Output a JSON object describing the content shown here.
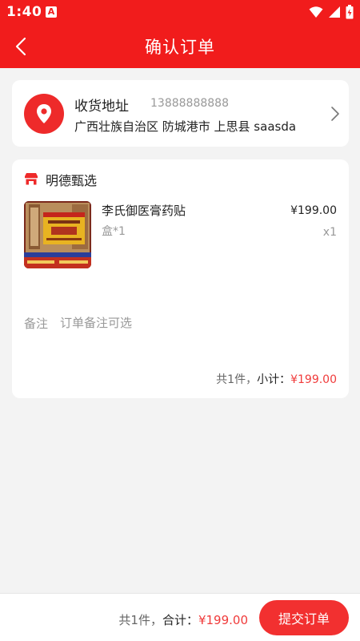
{
  "status_bar": {
    "time": "1:40",
    "app_icon_letter": "A"
  },
  "header": {
    "title": "确认订单"
  },
  "address": {
    "title": "收货地址",
    "phone": "13888888888",
    "detail": "广西壮族自治区 防城港市 上思县 saasda"
  },
  "store": {
    "name": "明德甄选"
  },
  "product": {
    "name": "李氏御医膏药贴",
    "spec": "盒*1",
    "price": "¥199.00",
    "quantity": "x1"
  },
  "remark": {
    "label": "备注",
    "placeholder": "订单备注可选"
  },
  "subtotal": {
    "count_text": "共1件，",
    "label": "小计：",
    "amount": "¥199.00"
  },
  "footer": {
    "count_text": "共1件，",
    "label": "合计：",
    "amount": "¥199.00",
    "submit_label": "提交订单"
  },
  "colors": {
    "brand": "#f11c1c",
    "price_red": "#f03b3b"
  }
}
